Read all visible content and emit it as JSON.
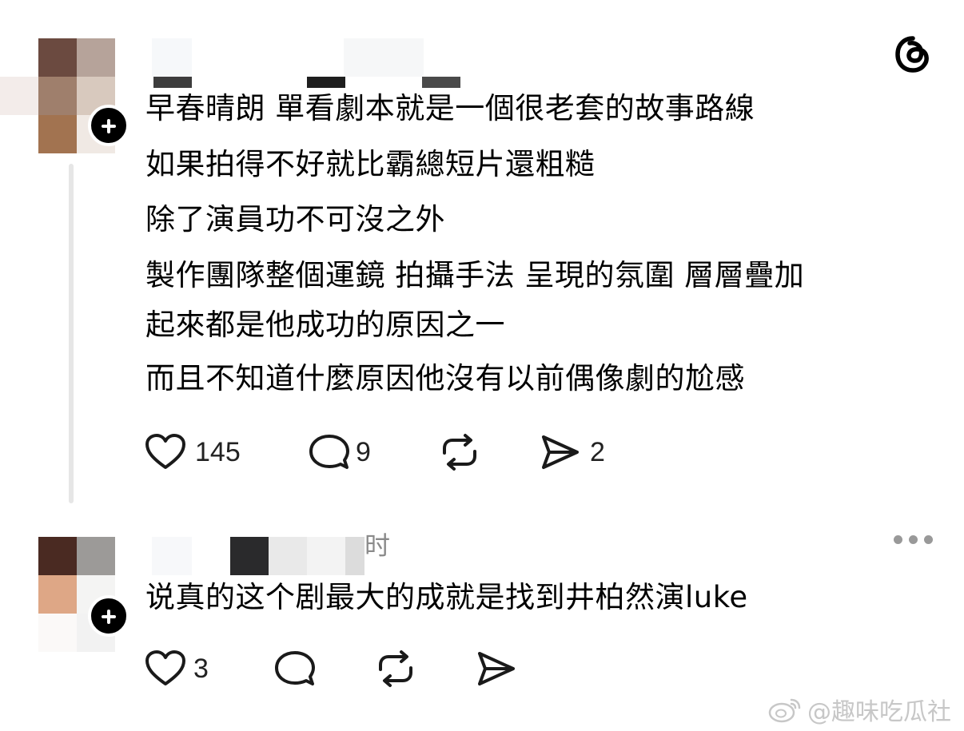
{
  "app": {
    "logo_icon": "threads-logo-icon"
  },
  "reply1": {
    "lines": [
      "早春晴朗 單看劇本就是一個很老套的故事路線",
      "如果拍得不好就比霸總短片還粗糙",
      "除了演員功不可沒之外",
      "製作團隊整個運鏡 拍攝手法 呈現的氛圍 層層疊加",
      "起來都是他成功的原因之一",
      "而且不知道什麼原因他沒有以前偶像劇的尬感"
    ],
    "likes": "145",
    "comments": "9",
    "shares": "2"
  },
  "reply2": {
    "time": "时",
    "text": "说真的这个剧最大的成就是找到井柏然演luke",
    "likes": "3"
  },
  "watermark": {
    "text": "@趣味吃瓜社",
    "icon": "weibo-icon"
  },
  "colors": {
    "icon_stroke": "#1a1a1a",
    "thread_line": "#e6e6e6",
    "muted_text": "#8a8a8a",
    "watermark": "#c7c7c7"
  }
}
